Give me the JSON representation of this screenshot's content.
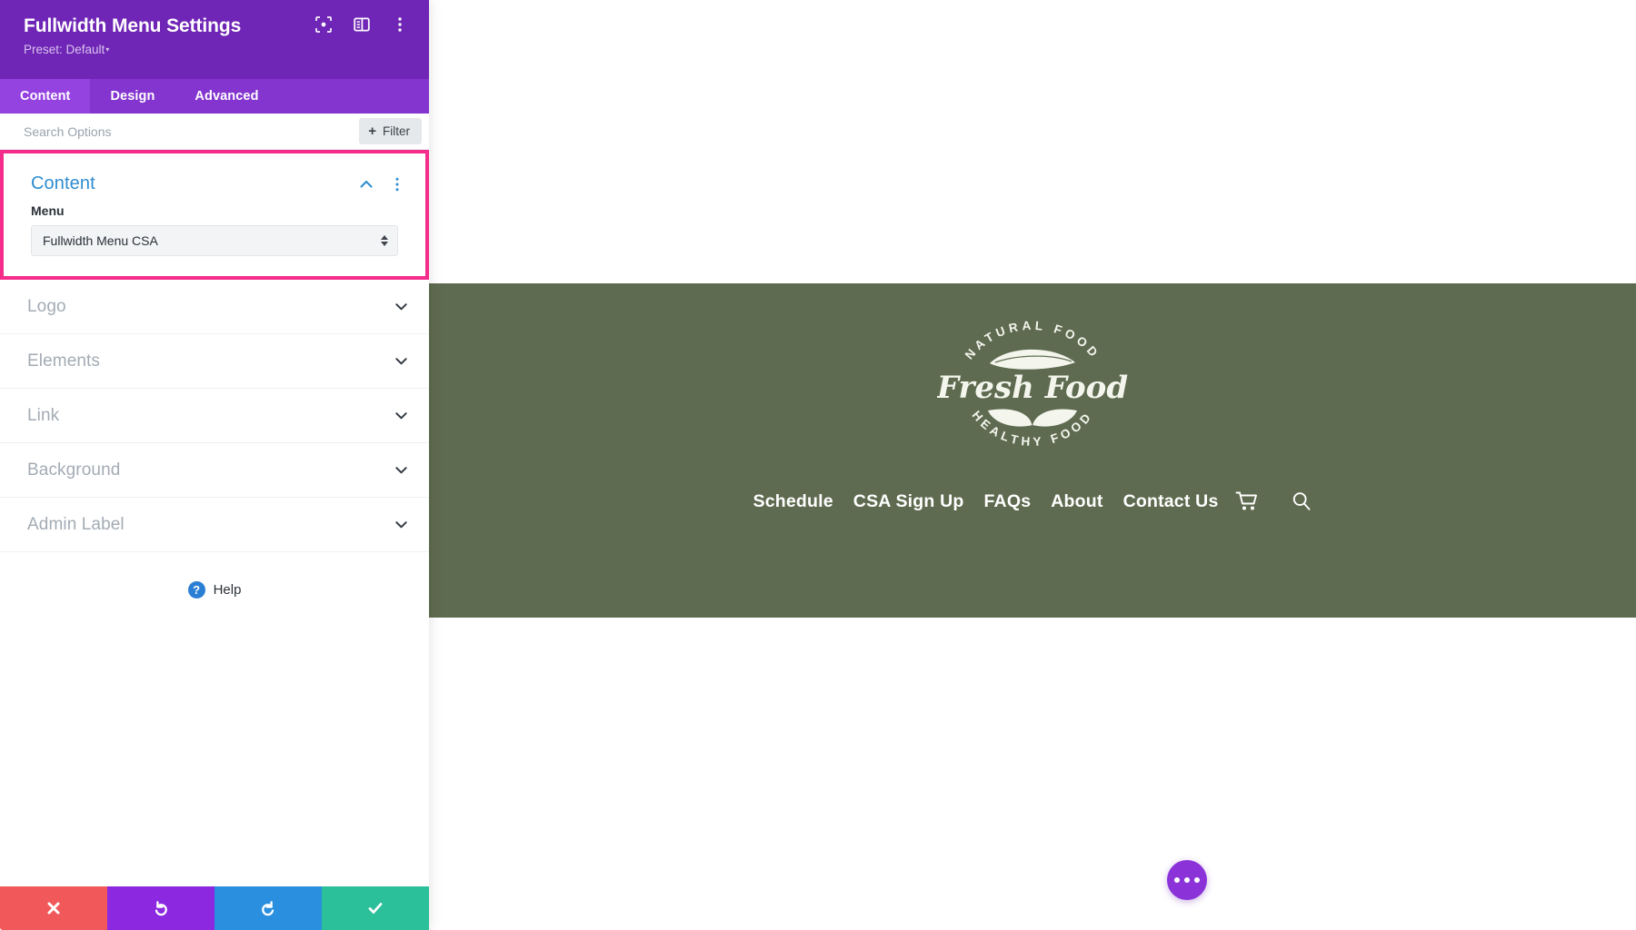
{
  "panel": {
    "title": "Fullwidth Menu Settings",
    "preset_label": "Preset: Default",
    "preset_caret": "▾",
    "header_icons": [
      {
        "name": "focus-icon"
      },
      {
        "name": "layout-panel-icon"
      },
      {
        "name": "more-options-icon"
      }
    ],
    "tabs": [
      {
        "label": "Content",
        "active": true
      },
      {
        "label": "Design",
        "active": false
      },
      {
        "label": "Advanced",
        "active": false
      }
    ],
    "search": {
      "placeholder": "Search Options",
      "value": ""
    },
    "filter_button": {
      "label": "Filter",
      "plus": "+"
    },
    "content_section": {
      "title": "Content",
      "highlighted": true,
      "highlight_color": "#f52d8a",
      "accent_color": "#2e8dd0",
      "field": {
        "label": "Menu",
        "value": "Fullwidth Menu CSA"
      }
    },
    "collapsed_sections": [
      {
        "label": "Logo"
      },
      {
        "label": "Elements"
      },
      {
        "label": "Link"
      },
      {
        "label": "Background"
      },
      {
        "label": "Admin Label"
      }
    ],
    "help": {
      "badge": "?",
      "label": "Help"
    },
    "footer_buttons": [
      {
        "name": "close-button",
        "icon": "cross-icon",
        "color": "#f0585a"
      },
      {
        "name": "undo-button",
        "icon": "undo-arrow-icon",
        "color": "#8c28e0"
      },
      {
        "name": "redo-button",
        "icon": "redo-arrow-icon",
        "color": "#2a8fde"
      },
      {
        "name": "save-button",
        "icon": "check-icon",
        "color": "#2bbf9a"
      }
    ]
  },
  "preview": {
    "band_color": "#5f6b50",
    "logo": {
      "top_arc_text": "NATURAL FOOD",
      "script_text": "Fresh Food",
      "bottom_arc_text": "HEALTHY FOOD"
    },
    "nav_items": [
      {
        "label": "Schedule"
      },
      {
        "label": "CSA Sign Up"
      },
      {
        "label": "FAQs"
      },
      {
        "label": "About"
      },
      {
        "label": "Contact Us"
      }
    ],
    "nav_icons": [
      {
        "name": "shopping-cart-icon"
      },
      {
        "name": "search-icon"
      }
    ],
    "fab": {
      "name": "page-settings-fab",
      "icon": "ellipsis-icon",
      "color": "#8b32d8"
    }
  }
}
